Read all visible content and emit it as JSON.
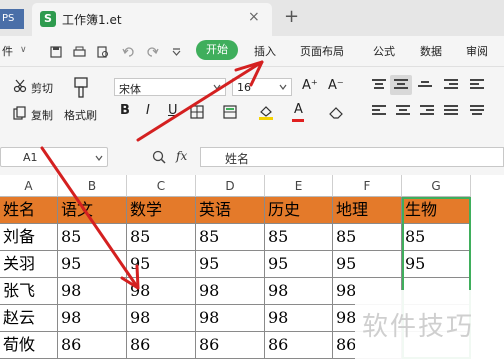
{
  "app_tab": "PS",
  "document_tab": {
    "title": "工作簿1.et",
    "close": "×",
    "icon": "S"
  },
  "new_tab": "+",
  "menu": {
    "file": "件",
    "file_arrow": "∨",
    "start": "开始",
    "items": [
      "插入",
      "页面布局",
      "公式",
      "数据",
      "审阅"
    ]
  },
  "toolbar": {
    "cut": "剪切",
    "copy": "复制",
    "format_painter": "格式刷",
    "font_name": "宋体",
    "font_size": "16",
    "bold": "B",
    "italic": "I",
    "underline": "U",
    "font_color_glyph": "A",
    "grow_font": "A⁺",
    "shrink_font": "A⁻"
  },
  "formula_bar": {
    "cell_ref": "A1",
    "fx": "fx",
    "content": "姓名"
  },
  "sheet": {
    "columns": [
      "A",
      "B",
      "C",
      "D",
      "E",
      "F",
      "G"
    ],
    "header_color": "#e47a2a",
    "header_row": [
      "姓名",
      "语文",
      "数学",
      "英语",
      "历史",
      "地理",
      "生物"
    ],
    "rows": [
      [
        "刘备",
        "85",
        "85",
        "85",
        "85",
        "85",
        "85"
      ],
      [
        "关羽",
        "95",
        "95",
        "95",
        "95",
        "95",
        "95"
      ],
      [
        "张飞",
        "98",
        "98",
        "98",
        "98",
        "98",
        ""
      ],
      [
        "赵云",
        "98",
        "98",
        "98",
        "98",
        "98",
        ""
      ],
      [
        "荀攸",
        "86",
        "86",
        "86",
        "86",
        "86",
        ""
      ]
    ]
  },
  "annotation": {
    "arrow_color": "#d42020"
  },
  "watermark": "软件技巧"
}
